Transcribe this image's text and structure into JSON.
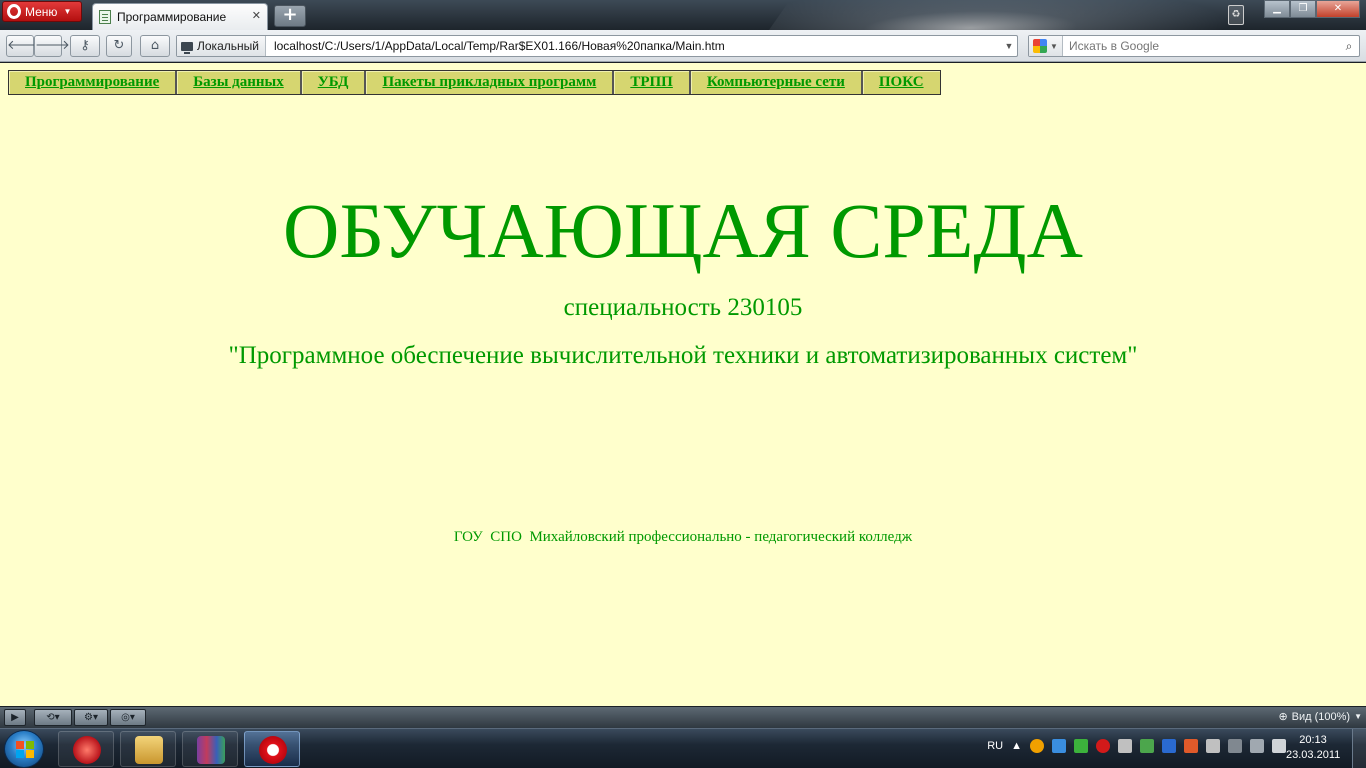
{
  "browser": {
    "menu_label": "Меню",
    "tab_title": "Программирование",
    "tab_close": "✕",
    "new_tab": "+",
    "address_badge": "Локальный",
    "address_url": "localhost/C:/Users/1/AppData/Local/Temp/Rar$EX01.166/Новая%20папка/Main.htm",
    "search_placeholder": "Искать в Google",
    "zoom_label": "Вид (100%)"
  },
  "page": {
    "nav": [
      {
        "label": "Программирование"
      },
      {
        "label": "Базы данных"
      },
      {
        "label": "УБД"
      },
      {
        "label": "Пакеты прикладных программ"
      },
      {
        "label": "ТРПП"
      },
      {
        "label": "Компьютерные сети"
      },
      {
        "label": "ПОКС"
      }
    ],
    "title": "ОБУЧАЮЩАЯ СРЕДА",
    "subtitle": "специальность 230105",
    "tagline": "\"Программное обеспечение вычислительной техники и автоматизированных систем\"",
    "footer": "ГОУ  СПО  Михайловский профессионально - педагогический колледж",
    "colors": {
      "background": "#ffffcc",
      "text": "#009900",
      "nav_bg": "#d6d670"
    }
  },
  "taskbar": {
    "language": "RU",
    "time": "20:13",
    "date": "23.03.2011"
  }
}
